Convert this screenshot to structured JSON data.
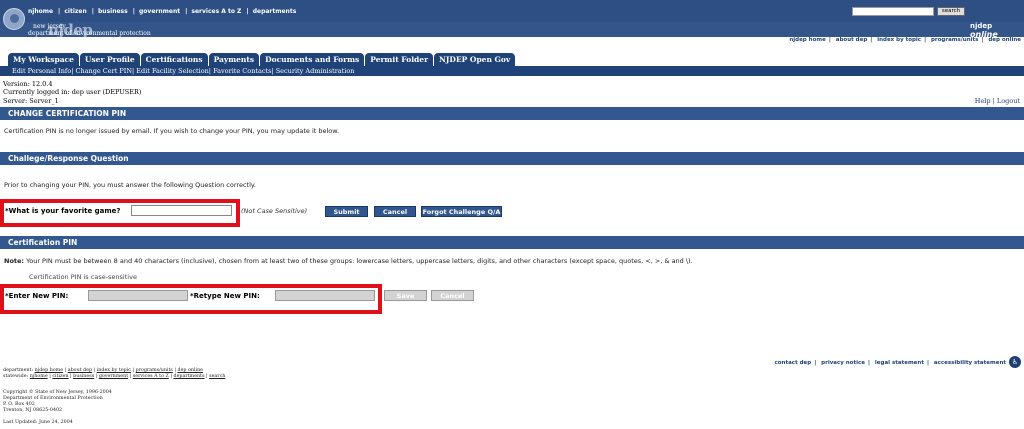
{
  "topnav": {
    "links": [
      "njhome",
      "citizen",
      "business",
      "government",
      "services A to Z",
      "departments"
    ],
    "search_button": "search"
  },
  "logo": {
    "state": "new jersey",
    "njdep": "njdep",
    "dept": "department of environmental protection",
    "online_prefix": "njdep",
    "online_suffix": "online"
  },
  "util_links": [
    "njdep home",
    "about dep",
    "index by topic",
    "programs/units",
    "dep online"
  ],
  "tabs": [
    "My Workspace",
    "User Profile",
    "Certifications",
    "Payments",
    "Documents and Forms",
    "Permit Folder",
    "NJDEP Open Gov"
  ],
  "subnav": [
    "Edit Personal Info",
    "Change Cert PIN",
    "Edit Facility Selection",
    "Favorite Contacts",
    "Security Administration"
  ],
  "info": {
    "version": "Version: 12.0.4",
    "logged_in": "Currently logged in: dep user (DEPUSER)",
    "server": "Server: Server_1"
  },
  "help_links": {
    "help": "Help",
    "logout": "Logout"
  },
  "section_change": {
    "title": "CHANGE CERTIFICATION PIN",
    "text": "Certification PIN is no longer issued by email. If you wish to change your PIN, you may update it below."
  },
  "section_challenge": {
    "title": "Challege/Response Question",
    "text": "Prior to changing your PIN, you must answer the following Question correctly.",
    "question_label": "*What is your favorite game?",
    "answer_value": "",
    "hint": "(Not Case Sensitive)",
    "submit": "Submit",
    "cancel": "Cancel",
    "forgot": "Forgot Challenge Q/A"
  },
  "section_pin": {
    "title": "Certification PIN",
    "note_label": "Note:",
    "note_text": "Your PIN must be between 8 and 40 characters (inclusive), chosen from at least two of these groups: lowercase letters, uppercase letters, digits, and other characters (except space, quotes, <, >, & and \\).",
    "case_note": "Certification PIN is case-sensitive",
    "new_pin_label": "*Enter New PIN:",
    "retype_label": "*Retype New PIN:",
    "save": "Save",
    "cancel": "Cancel"
  },
  "footer_links": [
    "contact dep",
    "privacy notice",
    "legal statement",
    "accessibility statement"
  ],
  "footer": {
    "department_label": "department:",
    "department_links": [
      "njdep home",
      "about dep",
      "index by topic",
      "programs/units",
      "dep online"
    ],
    "statewide_label": "statewide:",
    "statewide_links": [
      "njhome",
      "citizen",
      "business",
      "government",
      "services A to Z",
      "departments",
      "search"
    ],
    "copyright": "Copyright © State of New Jersey, 1996-2004",
    "dept_name": "Department of Environmental Protection",
    "po_box": "P. O. Box 402",
    "city": "Trenton, NJ 08625-0402",
    "last_updated": "Last Updated: June 24, 2004"
  },
  "colors": {
    "banner": "#2d4f84",
    "tab": "#1f4278",
    "section_bar": "#33588f",
    "highlight": "#e0101a",
    "disabled": "#d3d3d3"
  }
}
